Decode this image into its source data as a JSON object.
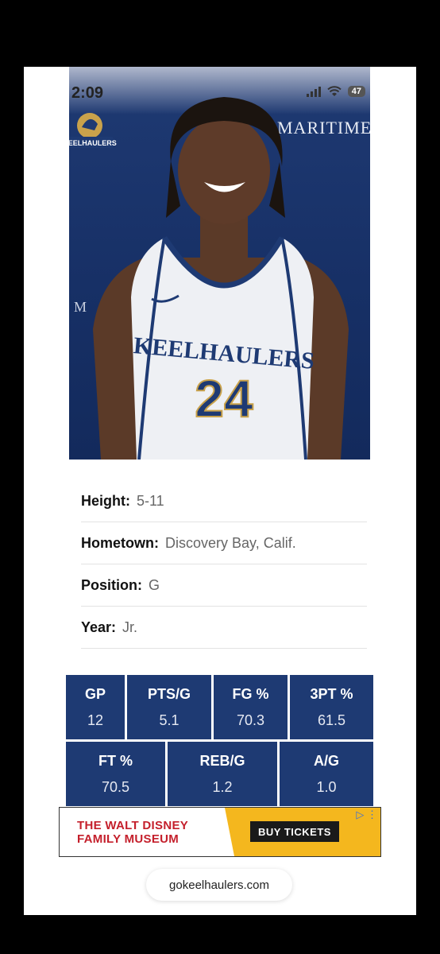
{
  "status_bar": {
    "time": "2:09",
    "battery": "47"
  },
  "photo": {
    "backdrop_text": "MARITIME",
    "side_letter": "M",
    "logo_text": "KEELHAULERS",
    "jersey_text": "KEELHAULERS",
    "jersey_number": "24"
  },
  "info": [
    {
      "label": "Height:",
      "value": "5-11"
    },
    {
      "label": "Hometown:",
      "value": "Discovery Bay, Calif."
    },
    {
      "label": "Position:",
      "value": "G"
    },
    {
      "label": "Year:",
      "value": "Jr."
    }
  ],
  "stats": {
    "row1": [
      {
        "label": "GP",
        "value": "12"
      },
      {
        "label": "PTS/G",
        "value": "5.1"
      },
      {
        "label": "FG %",
        "value": "70.3"
      },
      {
        "label": "3PT %",
        "value": "61.5"
      }
    ],
    "row2": [
      {
        "label": "FT %",
        "value": "70.5"
      },
      {
        "label": "REB/G",
        "value": "1.2"
      },
      {
        "label": "A/G",
        "value": "1.0"
      }
    ]
  },
  "ad": {
    "line1": "THE WALT DISNEY",
    "line2": "FAMILY MUSEUM",
    "button": "BUY TICKETS"
  },
  "url": "gokeelhaulers.com",
  "colors": {
    "navy": "#1e3a73",
    "ad_red": "#c41f2b",
    "ad_yellow": "#f4b71e"
  }
}
